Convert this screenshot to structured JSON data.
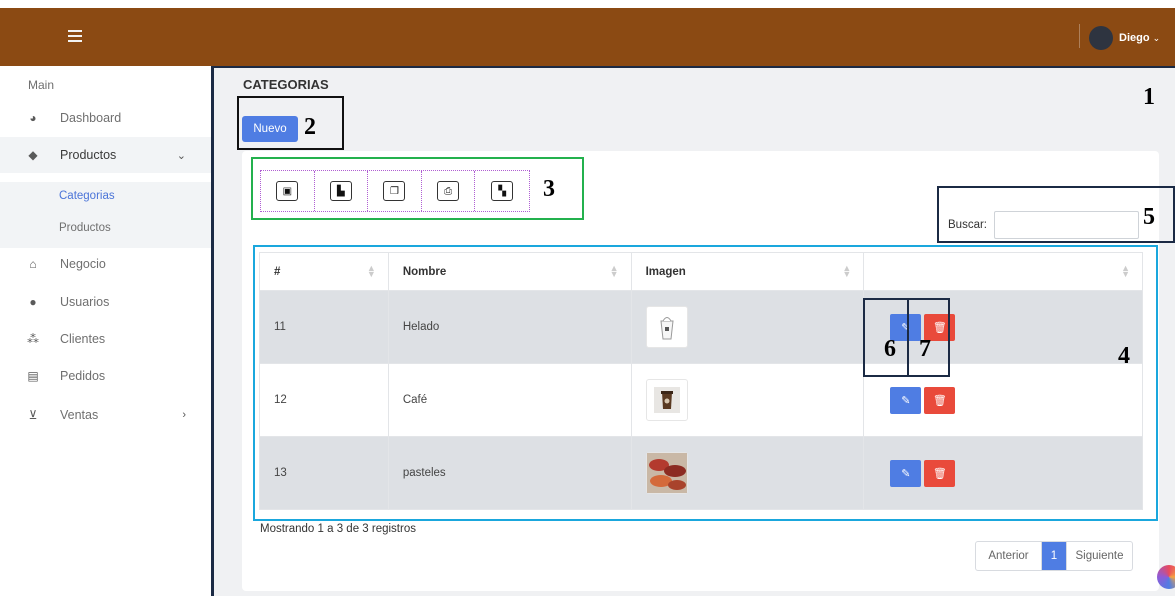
{
  "header": {
    "menu_icon": "hamburger-icon",
    "user": {
      "name": "Diego",
      "caret": "⌄"
    }
  },
  "sidebar": {
    "section_label": "Main",
    "items": [
      {
        "label": "Dashboard",
        "icon": "pie-chart-icon"
      },
      {
        "label": "Productos",
        "icon": "tags-icon",
        "arrow": "⌄",
        "expanded": true
      },
      {
        "label": "Negocio",
        "icon": "home-icon"
      },
      {
        "label": "Usuarios",
        "icon": "user-icon"
      },
      {
        "label": "Clientes",
        "icon": "users-icon"
      },
      {
        "label": "Pedidos",
        "icon": "list-icon"
      },
      {
        "label": "Ventas",
        "icon": "cart-icon",
        "arrow": "›"
      }
    ],
    "subitems": [
      {
        "label": "Categorias",
        "current": true
      },
      {
        "label": "Productos",
        "current": false
      }
    ]
  },
  "page": {
    "title": "CATEGORIAS",
    "new_button": "Nuevo"
  },
  "exports": [
    {
      "icon": "excel-icon"
    },
    {
      "icon": "pdf-icon"
    },
    {
      "icon": "copy-icon"
    },
    {
      "icon": "print-icon"
    },
    {
      "icon": "csv-icon"
    }
  ],
  "search": {
    "label": "Buscar:",
    "value": ""
  },
  "table": {
    "headers": [
      "#",
      "Nombre",
      "Imagen",
      ""
    ],
    "rows": [
      {
        "id": "11",
        "nombre": "Helado",
        "image": "ice-cream-cup-image"
      },
      {
        "id": "12",
        "nombre": "Café",
        "image": "coffee-cup-image"
      },
      {
        "id": "13",
        "nombre": "pasteles",
        "image": "pastries-image"
      }
    ]
  },
  "footer": {
    "info": "Mostrando 1 a 3 de 3 registros",
    "prev": "Anterior",
    "page": "1",
    "next": "Siguiente"
  },
  "annotations": [
    "1",
    "2",
    "3",
    "4",
    "5",
    "6",
    "7"
  ],
  "colors": {
    "topbar": "#8b4a13",
    "primary": "#4f7de3",
    "danger": "#e94a3b",
    "ann_dark": "#1b2a44",
    "ann_green": "#23b14d",
    "ann_cyan": "#1aa7dd"
  }
}
